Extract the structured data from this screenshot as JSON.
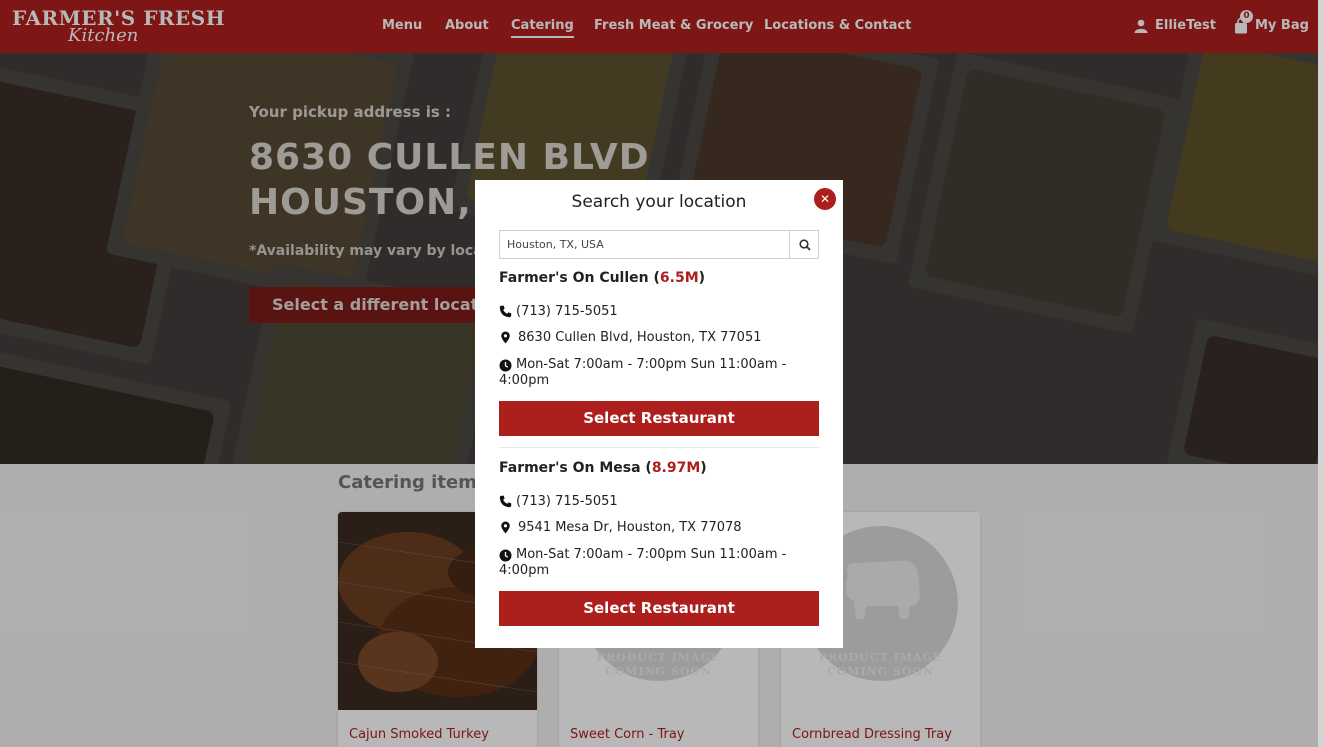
{
  "header": {
    "logo_line1": "FARMER'S FRESH",
    "logo_line2": "Kitchen",
    "nav": [
      "Menu",
      "About",
      "Catering",
      "Fresh Meat & Grocery",
      "Locations & Contact"
    ],
    "active_nav": "Catering",
    "user_name": "EllieTest",
    "bag_label": "My Bag",
    "bag_count": "0",
    "icons": {
      "user": "user-icon",
      "bag": "shopping-bag-icon"
    },
    "brand_color": "#ad1f1c"
  },
  "hero": {
    "pickup_label": "Your pickup address is :",
    "address_line1": "8630 CULLEN BLVD",
    "address_line2": "HOUSTON, TX",
    "availability_note": "*Availability may vary by location",
    "change_location_button": "Select a different location"
  },
  "catering": {
    "title": "Catering items",
    "items": [
      {
        "name": "Cajun Smoked Turkey",
        "image": "turkey-photo"
      },
      {
        "name": "Sweet Corn - Tray",
        "image": "placeholder"
      },
      {
        "name": "Cornbread Dressing Tray",
        "image": "placeholder"
      }
    ],
    "placeholder_line1": "PRODUCT IMAGE",
    "placeholder_line2": "COMING SOON"
  },
  "modal": {
    "title": "Search your location",
    "close_icon": "close-icon",
    "search_value": "Houston, TX, USA",
    "search_icon": "search-icon",
    "restaurants": [
      {
        "name": "Farmer's On Cullen",
        "distance": "6.5M",
        "phone": "(713) 715-5051",
        "address": "8630 Cullen Blvd, Houston, TX 77051",
        "hours": "Mon-Sat 7:00am - 7:00pm Sun 11:00am - 4:00pm",
        "button": "Select Restaurant"
      },
      {
        "name": "Farmer's On Mesa",
        "distance": "8.97M",
        "phone": "(713) 715-5051",
        "address": "9541 Mesa Dr, Houston, TX 77078",
        "hours": "Mon-Sat 7:00am - 7:00pm Sun 11:00am - 4:00pm",
        "button": "Select Restaurant"
      }
    ]
  }
}
